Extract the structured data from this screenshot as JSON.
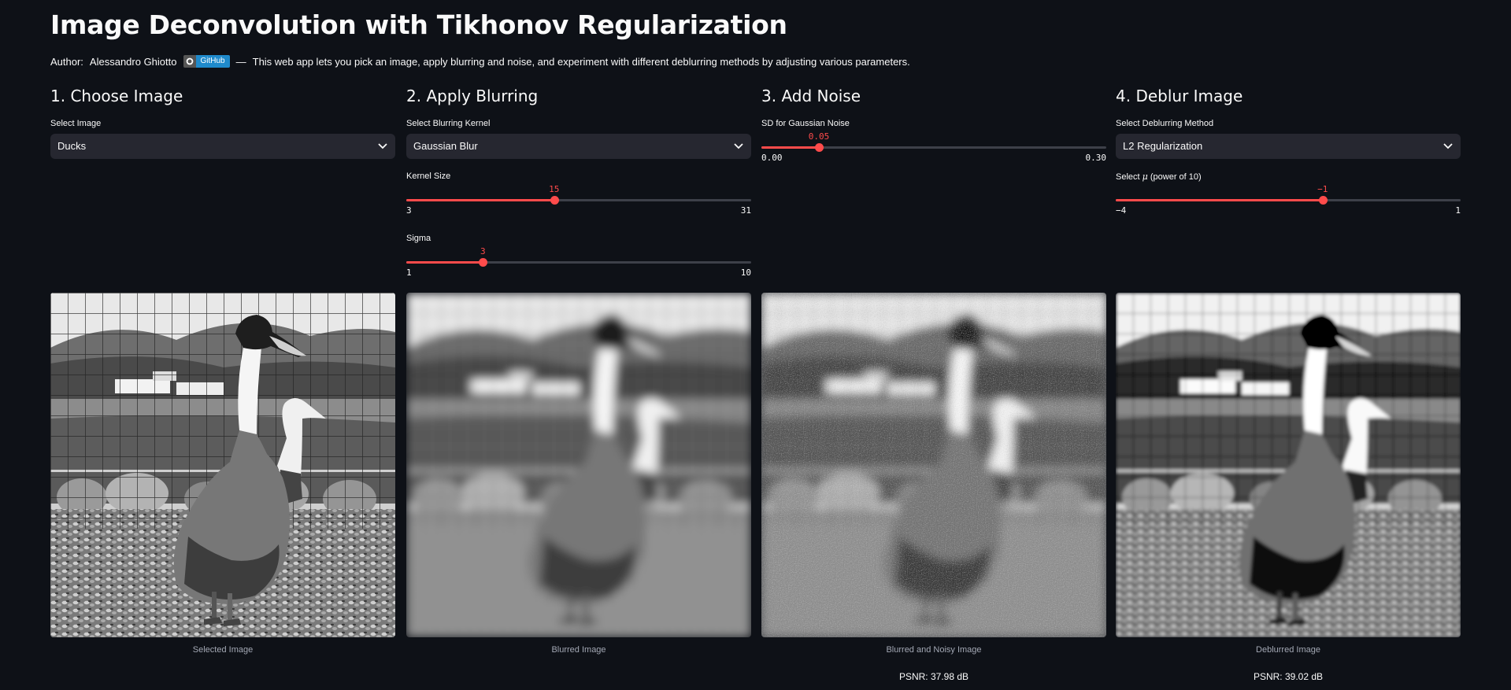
{
  "header": {
    "title": "Image Deconvolution with Tikhonov Regularization",
    "author_label": "Author:",
    "author_name": "Alessandro Ghiotto",
    "github_badge": "GitHub",
    "dash": "—",
    "description": "This web app lets you pick an image, apply blurring and noise, and experiment with different deblurring methods by adjusting various parameters."
  },
  "steps": {
    "choose": {
      "heading": "1. Choose Image",
      "select_label": "Select Image",
      "selected": "Ducks"
    },
    "blur": {
      "heading": "2. Apply Blurring",
      "select_label": "Select Blurring Kernel",
      "selected": "Gaussian Blur",
      "kernel_size": {
        "label": "Kernel Size",
        "value": 15,
        "value_text": "15",
        "min": 3,
        "max": 31,
        "min_text": "3",
        "max_text": "31"
      },
      "sigma": {
        "label": "Sigma",
        "value": 3,
        "value_text": "3",
        "min": 1,
        "max": 10,
        "min_text": "1",
        "max_text": "10"
      }
    },
    "noise": {
      "heading": "3. Add Noise",
      "sd": {
        "label": "SD for Gaussian Noise",
        "value": 0.05,
        "value_text": "0.05",
        "min": 0,
        "max": 0.3,
        "min_text": "0.00",
        "max_text": "0.30"
      }
    },
    "deblur": {
      "heading": "4. Deblur Image",
      "select_label": "Select Deblurring Method",
      "selected": "L2 Regularization",
      "mu": {
        "label_prefix": "Select ",
        "label_symbol": "μ",
        "label_suffix": " (power of 10)",
        "value": -1,
        "value_text": "−1",
        "min": -4,
        "max": 1,
        "min_text": "−4",
        "max_text": "1"
      }
    }
  },
  "images": {
    "selected": {
      "caption": "Selected Image"
    },
    "blurred": {
      "caption": "Blurred Image"
    },
    "noisy": {
      "caption": "Blurred and Noisy Image",
      "psnr": "PSNR: 37.98 dB"
    },
    "deblurred": {
      "caption": "Deblurred Image",
      "psnr": "PSNR: 39.02 dB"
    }
  },
  "colors": {
    "background": "#0e1117",
    "accent": "#ff4b4b",
    "widget_bg": "#262730",
    "track": "#3d4049"
  }
}
